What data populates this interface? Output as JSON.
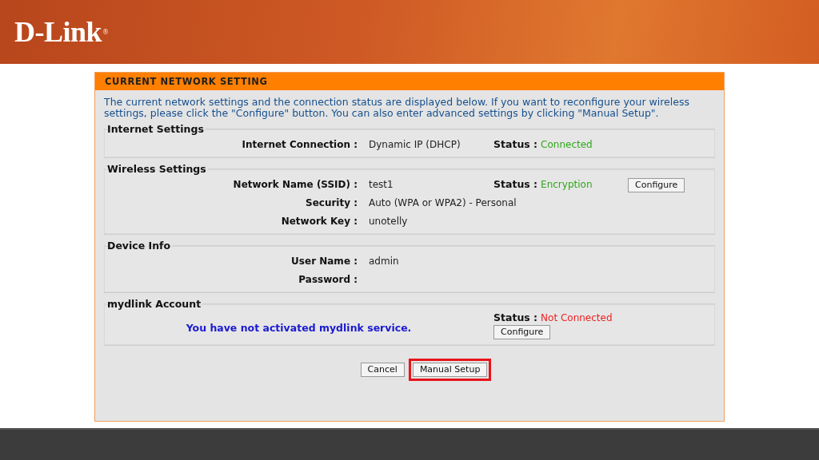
{
  "header": {
    "logo": "D-Link",
    "logo_mark": "®"
  },
  "panel": {
    "title": "CURRENT NETWORK SETTING",
    "intro": "The current network settings and the connection status are displayed below. If you want to reconfigure your wireless settings, please click the \"Configure\" button. You can also enter advanced settings by clicking \"Manual Setup\".",
    "sections": [
      {
        "kind": "info",
        "legend": "Internet Settings",
        "rows": [
          {
            "label": "Internet Connection :",
            "value": "Dynamic IP (DHCP)",
            "status": {
              "label": "Status :",
              "value": "Connected",
              "color": "#2fa81a"
            }
          }
        ]
      },
      {
        "kind": "info",
        "legend": "Wireless Settings",
        "rows": [
          {
            "label": "Network Name (SSID) :",
            "value": "test1",
            "status": {
              "label": "Status :",
              "value": "Encryption",
              "color": "#2fa81a"
            },
            "button": "Configure"
          },
          {
            "label": "Security :",
            "value": "Auto (WPA or WPA2) - Personal"
          },
          {
            "label": "Network Key :",
            "value": "unotelly"
          }
        ]
      },
      {
        "kind": "info",
        "legend": "Device Info",
        "rows": [
          {
            "label": "User Name :",
            "value": "admin"
          },
          {
            "label": "Password :"
          }
        ]
      },
      {
        "kind": "account",
        "legend": "mydlink Account",
        "message": "You have not activated mydlink service.",
        "status": {
          "label": "Status :",
          "value": "Not Connected",
          "color": "#ee2222"
        },
        "button": "Configure"
      }
    ],
    "buttons": [
      {
        "label": "Cancel",
        "highlighted": false
      },
      {
        "label": "Manual Setup",
        "highlighted": true
      }
    ]
  }
}
